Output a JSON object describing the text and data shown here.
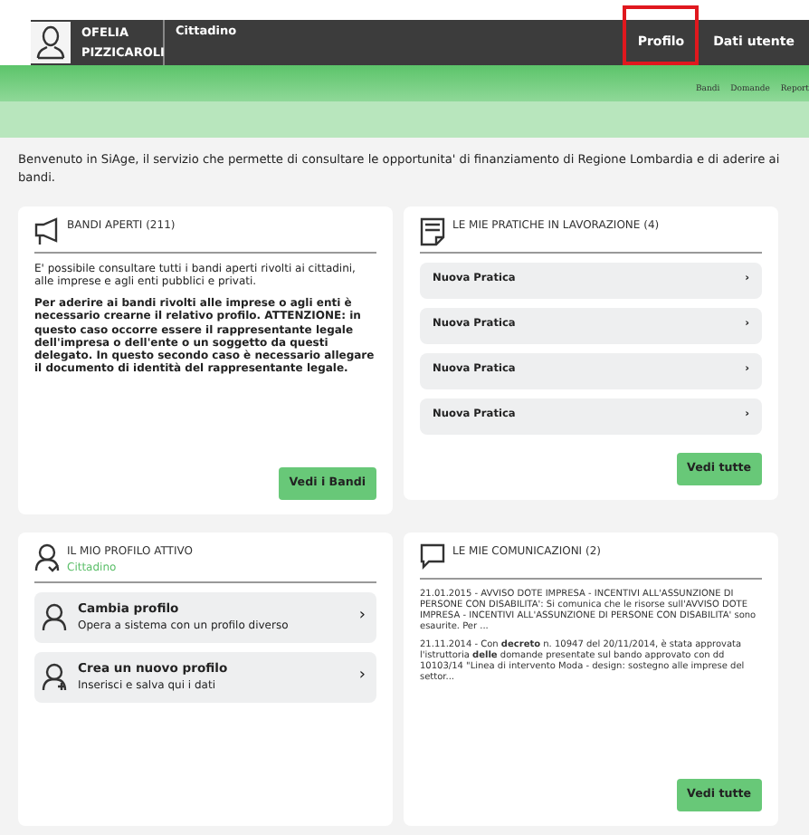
{
  "header": {
    "user_name": "OFELIA PIZZICAROLI",
    "role": "Cittadino",
    "nav": [
      {
        "label": "Profilo",
        "highlighted": true
      },
      {
        "label": "Dati utente",
        "highlighted": false
      }
    ],
    "subnav": [
      "Bandi",
      "Domande",
      "Report"
    ]
  },
  "welcome": "Benvenuto in SiAge, il servizio che permette di consultare le opportunita' di finanziamento di Regione Lombardia e di aderire ai bandi.",
  "bandi": {
    "title": "BANDI APERTI (211)",
    "paragraphs": [
      {
        "text": "E' possibile consultare tutti i bandi aperti rivolti ai cittadini, alle imprese e agli enti pubblici e privati.",
        "bold": false
      },
      {
        "text": "Per aderire ai bandi rivolti alle imprese o agli enti è necessario crearne il relativo profilo. ATTENZIONE: in questo caso occorre essere il rappresentante legale dell'impresa o dell'ente o un soggetto da questi delegato. In questo secondo caso è necessario allegare il documento di identità del rappresentante legale.",
        "bold": true
      }
    ],
    "button": "Vedi i Bandi"
  },
  "pratiche": {
    "title": "LE MIE PRATICHE IN LAVORAZIONE (4)",
    "items": [
      {
        "label": "Nuova Pratica",
        "arrow": "›"
      },
      {
        "label": "Nuova Pratica",
        "arrow": "›"
      },
      {
        "label": "Nuova Pratica",
        "arrow": "›"
      },
      {
        "label": "Nuova Pratica",
        "arrow": "›"
      }
    ],
    "button": "Vedi tutte"
  },
  "profilo": {
    "title": "IL MIO PROFILO ATTIVO",
    "subtitle": "Cittadino",
    "items": [
      {
        "kind": "switch",
        "title": "Cambia profilo",
        "description": "Opera a sistema con un profilo diverso",
        "arrow": "›"
      },
      {
        "kind": "add",
        "title": "Crea un nuovo profilo",
        "description": "Inserisci e salva qui i dati",
        "arrow": "›"
      }
    ]
  },
  "comunicazioni": {
    "title": "LE MIE COMUNICAZIONI (2)",
    "messages": [
      "21.01.2015 - AVVISO DOTE IMPRESA - INCENTIVI ALL'ASSUNZIONE DI PERSONE CON DISABILITA': Si comunica che le risorse sull'AVVISO DOTE IMPRESA - INCENTIVI ALL'ASSUNZIONE DI PERSONE CON DISABILITA' sono esaurite. Per ...",
      "21.11.2014 - Con **decreto** n. 10947 del 20/11/2014, è stata approvata l'istruttoria **delle** domande presentate sul bando approvato con dd 10103/14 \"Linea di intervento Moda - design: sostegno alle imprese del settor..."
    ],
    "button": "Vedi tutte"
  }
}
